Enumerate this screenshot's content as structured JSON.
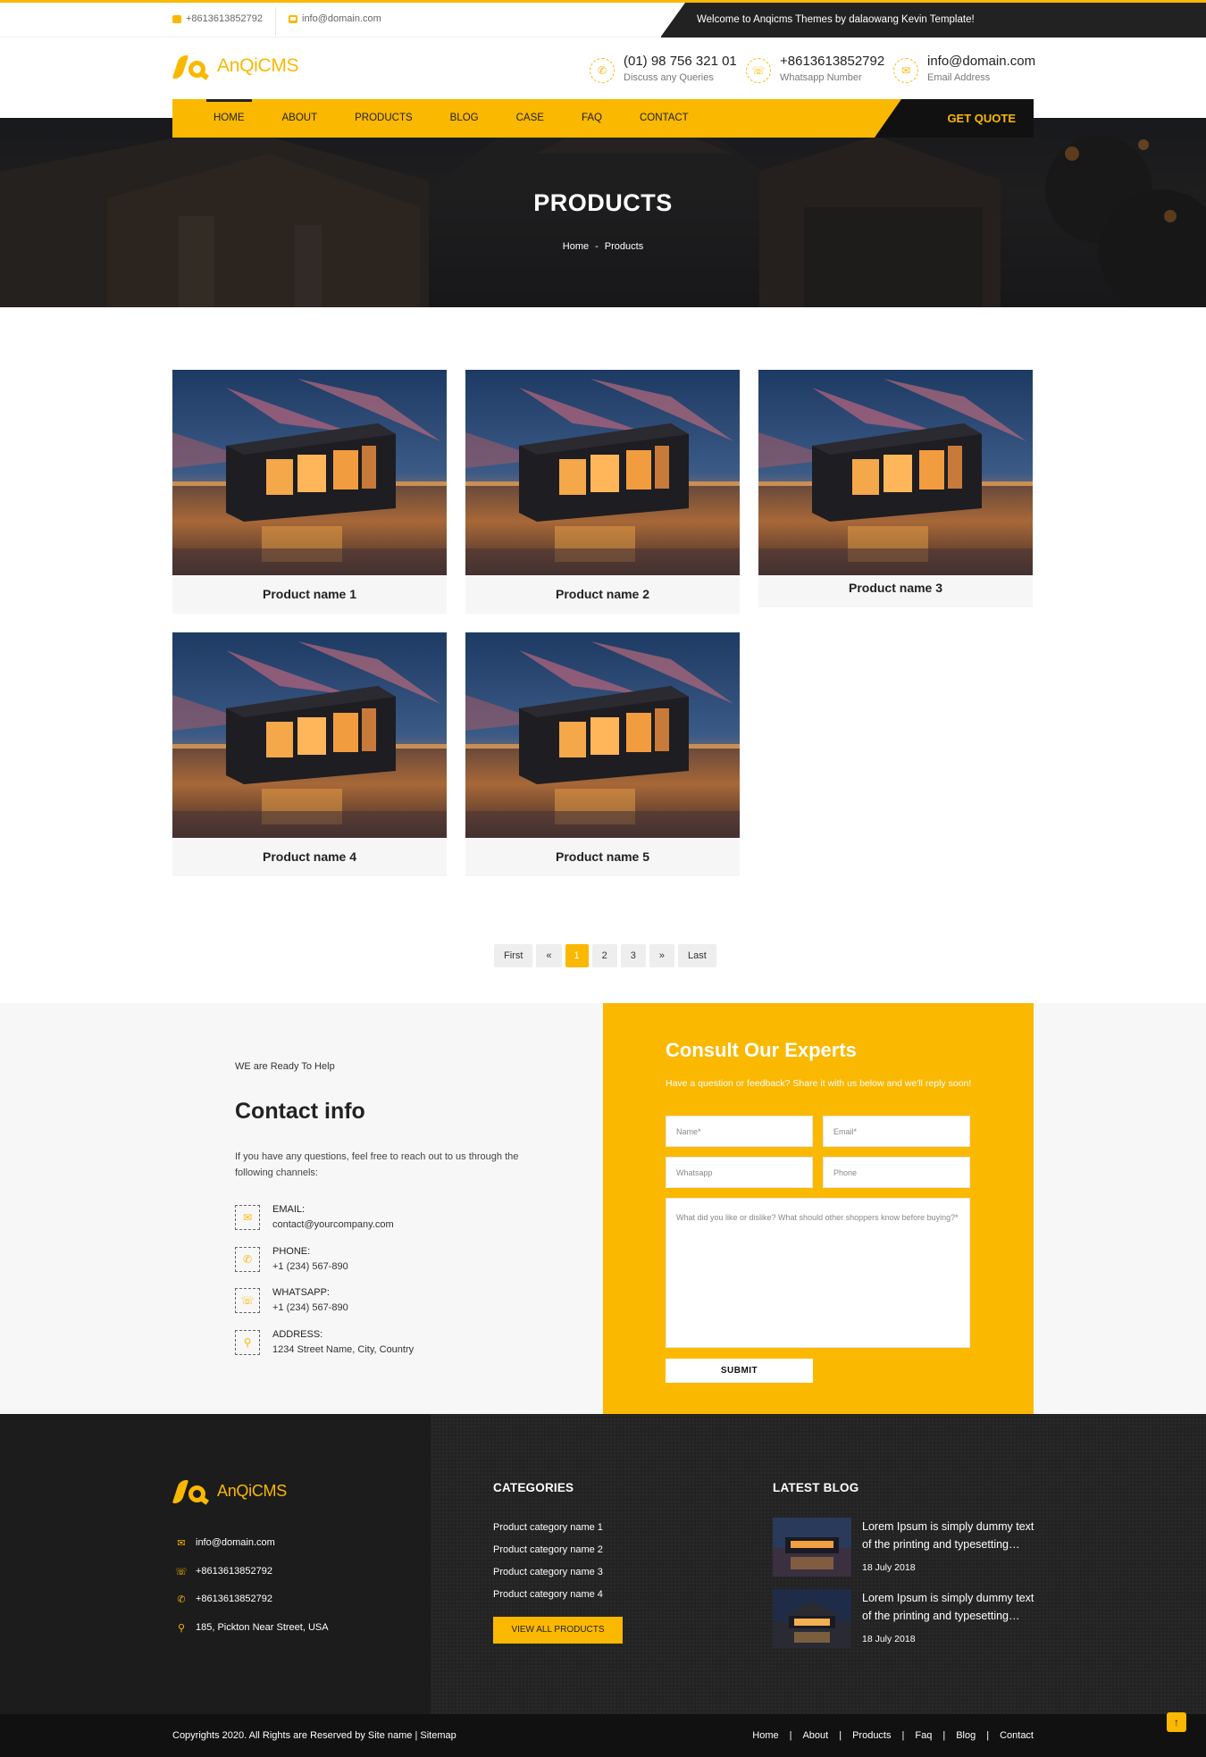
{
  "topbar": {
    "phone": "+8613613852792",
    "email": "info@domain.com",
    "welcome": "Welcome to Anqicms Themes by dalaowang Kevin Template!"
  },
  "header": {
    "logo_text": "AnQiCMS",
    "info": [
      {
        "big": "(01) 98 756 321 01",
        "small": "Discuss any Queries",
        "icon": "phone-icon"
      },
      {
        "big": "+8613613852792",
        "small": "Whatsapp Number",
        "icon": "whatsapp-icon"
      },
      {
        "big": "info@domain.com",
        "small": "Email Address",
        "icon": "mail-icon"
      }
    ]
  },
  "nav": {
    "items": [
      "HOME",
      "ABOUT",
      "PRODUCTS",
      "BLOG",
      "CASE",
      "FAQ",
      "CONTACT"
    ],
    "active": "HOME",
    "quote": "GET QUOTE"
  },
  "banner": {
    "title": "PRODUCTS",
    "crumb_home": "Home",
    "crumb_sep": "-",
    "crumb_current": "Products"
  },
  "products": [
    "Product name 1",
    "Product name 2",
    "Product name 3",
    "Product name 4",
    "Product name 5"
  ],
  "pager": {
    "first": "First",
    "prev": "«",
    "pages": [
      "1",
      "2",
      "3"
    ],
    "current": "1",
    "next": "»",
    "last": "Last"
  },
  "contact": {
    "ready": "WE are Ready To Help",
    "title": "Contact info",
    "desc": "If you have any questions, feel free to reach out to us through the following channels:",
    "items": [
      {
        "label": "EMAIL:",
        "value": "contact@yourcompany.com"
      },
      {
        "label": "PHONE:",
        "value": "+1 (234) 567-890"
      },
      {
        "label": "WHATSAPP:",
        "value": "+1 (234) 567-890"
      },
      {
        "label": "ADDRESS:",
        "value": "1234 Street Name, City, Country"
      }
    ]
  },
  "form": {
    "title": "Consult Our Experts",
    "sub": "Have a question or feedback? Share it with us below and we'll reply soon!",
    "name_ph": "Name*",
    "email_ph": "Email*",
    "whatsapp_ph": "Whatsapp",
    "phone_ph": "Phone",
    "message_ph": "What did you like or dislike? What should other shoppers know before buying?*",
    "submit": "SUBMIT"
  },
  "footer": {
    "logo_text": "AnQiCMS",
    "email": "info@domain.com",
    "whatsapp": "+8613613852792",
    "phone": "+8613613852792",
    "address": "185, Pickton Near Street, USA",
    "categories_title": "CATEGORIES",
    "categories": [
      "Product category name 1",
      "Product category name 2",
      "Product category name 3",
      "Product category name 4"
    ],
    "view_all": "VIEW ALL PRODUCTS",
    "blog_title": "LATEST BLOG",
    "blogs": [
      {
        "title": "Lorem Ipsum is simply dummy text of the printing and typesetting industry",
        "date": "18 July 2018"
      },
      {
        "title": "Lorem Ipsum is simply dummy text of the printing and typesetting industry",
        "date": "18 July 2018"
      }
    ]
  },
  "bottom": {
    "copyright": "Copyrights 2020. All Rights are Reserved by Site name | Sitemap",
    "links": [
      "Home",
      "About",
      "Products",
      "Faq",
      "Blog",
      "Contact"
    ],
    "to_top": "↑"
  },
  "colors": {
    "accent": "#fbb800",
    "dark": "#222222"
  }
}
